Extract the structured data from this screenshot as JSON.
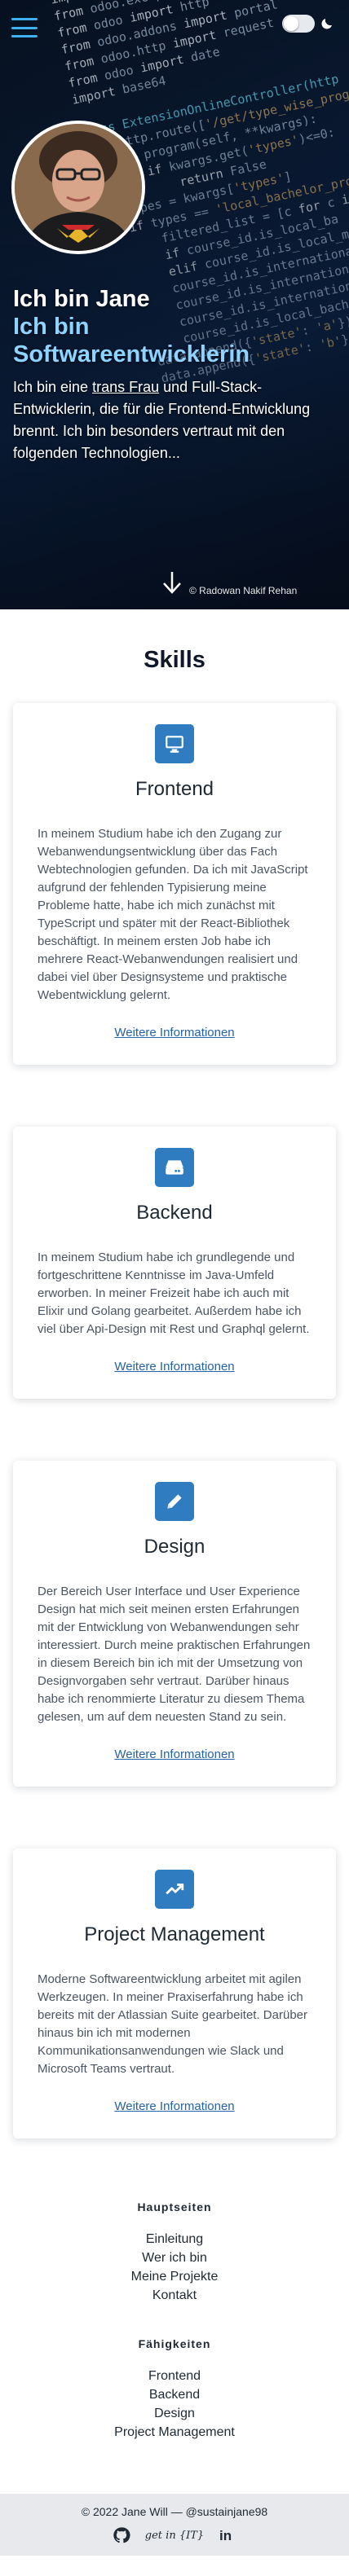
{
  "hero": {
    "title_line1": "Ich bin Jane",
    "title_line2": "Ich bin",
    "title_line3": "Softwareentwicklerin",
    "intro_before": "Ich bin eine ",
    "intro_link": "trans Frau",
    "intro_after": " und Full-Stack-Entwicklerin, die für die Frontend-Entwicklung brennt. Ich bin besonders vertraut mit den folgenden Technologien...",
    "photo_credit": "© Radowan Nakif Rehan",
    "menu_icon": "hamburger-menu-icon",
    "theme_icon": "moon-icon",
    "accent_color": "#8fd3ff"
  },
  "skills": {
    "title": "Skills",
    "cards": [
      {
        "title": "Frontend",
        "icon": "monitor-icon",
        "text": "In meinem Studium habe ich den Zugang zur Webanwendungsentwicklung über das Fach Webtechnologien gefunden. Da ich mit JavaScript aufgrund der fehlenden Typisierung meine Probleme hatte, habe ich mich zunächst mit TypeScript und später mit der React-Bibliothek beschäftigt. In meinem ersten Job habe ich mehrere React-Webanwendungen realisiert und dabei viel über Designsysteme und praktische Webentwicklung gelernt.",
        "link": "Weitere Informationen"
      },
      {
        "title": "Backend",
        "icon": "server-icon",
        "text": "In meinem Studium habe ich grundlegende und fortgeschrittene Kenntnisse im Java-Umfeld erworben. In meiner Freizeit habe ich auch mit Elixir und Golang gearbeitet. Außerdem habe ich viel über Api-Design mit Rest und Graphql gelernt.",
        "link": "Weitere Informationen"
      },
      {
        "title": "Design",
        "icon": "pencil-icon",
        "text": "Der Bereich User Interface und User Experience Design hat mich seit meinen ersten Erfahrungen mit der Entwicklung von Webanwendungen sehr interessiert. Durch meine praktischen Erfahrungen in diesem Bereich bin ich mit der Umsetzung von Designvorgaben sehr vertraut. Darüber hinaus habe ich renommierte Literatur zu diesem Thema gelesen, um auf dem neuesten Stand zu sein.",
        "link": "Weitere Informationen"
      },
      {
        "title": "Project Management",
        "icon": "trending-up-icon",
        "text": "Moderne Softwareentwicklung arbeitet mit agilen Werkzeugen. In meiner Praxiserfahrung habe ich bereits mit der Atlassian Suite gearbeitet. Darüber hinaus bin ich mit modernen Kommunikationsanwendungen wie Slack und Microsoft Teams vertraut.",
        "link": "Weitere Informationen"
      }
    ]
  },
  "footer": {
    "main_heading": "Hauptseiten",
    "main_links": [
      "Einleitung",
      "Wer ich bin",
      "Meine Projekte",
      "Kontakt"
    ],
    "skills_heading": "Fähigkeiten",
    "skills_links": [
      "Frontend",
      "Backend",
      "Design",
      "Project Management"
    ],
    "copyright": "© 2022 Jane Will — @sustainjane98",
    "social": [
      {
        "name": "github-icon"
      },
      {
        "name": "get-in-it-logo",
        "label": "get in {IT}"
      },
      {
        "name": "linkedin-icon",
        "label": "in"
      }
    ]
  },
  "colors": {
    "icon_bg": "#2f7cc0",
    "link": "#2563a8",
    "menu": "#3fb0f0",
    "footer_bg": "#e7e9ed"
  }
}
